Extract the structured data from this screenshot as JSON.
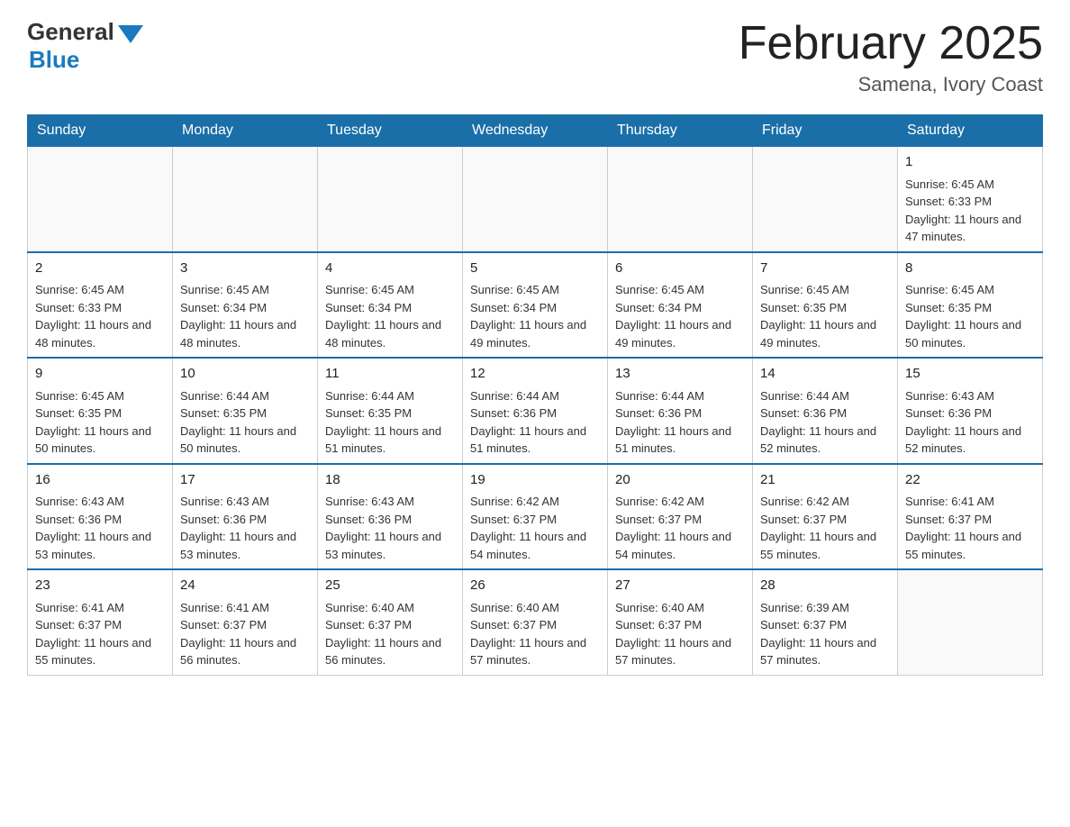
{
  "header": {
    "logo_general": "General",
    "logo_blue": "Blue",
    "title": "February 2025",
    "subtitle": "Samena, Ivory Coast"
  },
  "weekdays": [
    "Sunday",
    "Monday",
    "Tuesday",
    "Wednesday",
    "Thursday",
    "Friday",
    "Saturday"
  ],
  "weeks": [
    [
      {
        "day": "",
        "info": ""
      },
      {
        "day": "",
        "info": ""
      },
      {
        "day": "",
        "info": ""
      },
      {
        "day": "",
        "info": ""
      },
      {
        "day": "",
        "info": ""
      },
      {
        "day": "",
        "info": ""
      },
      {
        "day": "1",
        "info": "Sunrise: 6:45 AM\nSunset: 6:33 PM\nDaylight: 11 hours and 47 minutes."
      }
    ],
    [
      {
        "day": "2",
        "info": "Sunrise: 6:45 AM\nSunset: 6:33 PM\nDaylight: 11 hours and 48 minutes."
      },
      {
        "day": "3",
        "info": "Sunrise: 6:45 AM\nSunset: 6:34 PM\nDaylight: 11 hours and 48 minutes."
      },
      {
        "day": "4",
        "info": "Sunrise: 6:45 AM\nSunset: 6:34 PM\nDaylight: 11 hours and 48 minutes."
      },
      {
        "day": "5",
        "info": "Sunrise: 6:45 AM\nSunset: 6:34 PM\nDaylight: 11 hours and 49 minutes."
      },
      {
        "day": "6",
        "info": "Sunrise: 6:45 AM\nSunset: 6:34 PM\nDaylight: 11 hours and 49 minutes."
      },
      {
        "day": "7",
        "info": "Sunrise: 6:45 AM\nSunset: 6:35 PM\nDaylight: 11 hours and 49 minutes."
      },
      {
        "day": "8",
        "info": "Sunrise: 6:45 AM\nSunset: 6:35 PM\nDaylight: 11 hours and 50 minutes."
      }
    ],
    [
      {
        "day": "9",
        "info": "Sunrise: 6:45 AM\nSunset: 6:35 PM\nDaylight: 11 hours and 50 minutes."
      },
      {
        "day": "10",
        "info": "Sunrise: 6:44 AM\nSunset: 6:35 PM\nDaylight: 11 hours and 50 minutes."
      },
      {
        "day": "11",
        "info": "Sunrise: 6:44 AM\nSunset: 6:35 PM\nDaylight: 11 hours and 51 minutes."
      },
      {
        "day": "12",
        "info": "Sunrise: 6:44 AM\nSunset: 6:36 PM\nDaylight: 11 hours and 51 minutes."
      },
      {
        "day": "13",
        "info": "Sunrise: 6:44 AM\nSunset: 6:36 PM\nDaylight: 11 hours and 51 minutes."
      },
      {
        "day": "14",
        "info": "Sunrise: 6:44 AM\nSunset: 6:36 PM\nDaylight: 11 hours and 52 minutes."
      },
      {
        "day": "15",
        "info": "Sunrise: 6:43 AM\nSunset: 6:36 PM\nDaylight: 11 hours and 52 minutes."
      }
    ],
    [
      {
        "day": "16",
        "info": "Sunrise: 6:43 AM\nSunset: 6:36 PM\nDaylight: 11 hours and 53 minutes."
      },
      {
        "day": "17",
        "info": "Sunrise: 6:43 AM\nSunset: 6:36 PM\nDaylight: 11 hours and 53 minutes."
      },
      {
        "day": "18",
        "info": "Sunrise: 6:43 AM\nSunset: 6:36 PM\nDaylight: 11 hours and 53 minutes."
      },
      {
        "day": "19",
        "info": "Sunrise: 6:42 AM\nSunset: 6:37 PM\nDaylight: 11 hours and 54 minutes."
      },
      {
        "day": "20",
        "info": "Sunrise: 6:42 AM\nSunset: 6:37 PM\nDaylight: 11 hours and 54 minutes."
      },
      {
        "day": "21",
        "info": "Sunrise: 6:42 AM\nSunset: 6:37 PM\nDaylight: 11 hours and 55 minutes."
      },
      {
        "day": "22",
        "info": "Sunrise: 6:41 AM\nSunset: 6:37 PM\nDaylight: 11 hours and 55 minutes."
      }
    ],
    [
      {
        "day": "23",
        "info": "Sunrise: 6:41 AM\nSunset: 6:37 PM\nDaylight: 11 hours and 55 minutes."
      },
      {
        "day": "24",
        "info": "Sunrise: 6:41 AM\nSunset: 6:37 PM\nDaylight: 11 hours and 56 minutes."
      },
      {
        "day": "25",
        "info": "Sunrise: 6:40 AM\nSunset: 6:37 PM\nDaylight: 11 hours and 56 minutes."
      },
      {
        "day": "26",
        "info": "Sunrise: 6:40 AM\nSunset: 6:37 PM\nDaylight: 11 hours and 57 minutes."
      },
      {
        "day": "27",
        "info": "Sunrise: 6:40 AM\nSunset: 6:37 PM\nDaylight: 11 hours and 57 minutes."
      },
      {
        "day": "28",
        "info": "Sunrise: 6:39 AM\nSunset: 6:37 PM\nDaylight: 11 hours and 57 minutes."
      },
      {
        "day": "",
        "info": ""
      }
    ]
  ]
}
